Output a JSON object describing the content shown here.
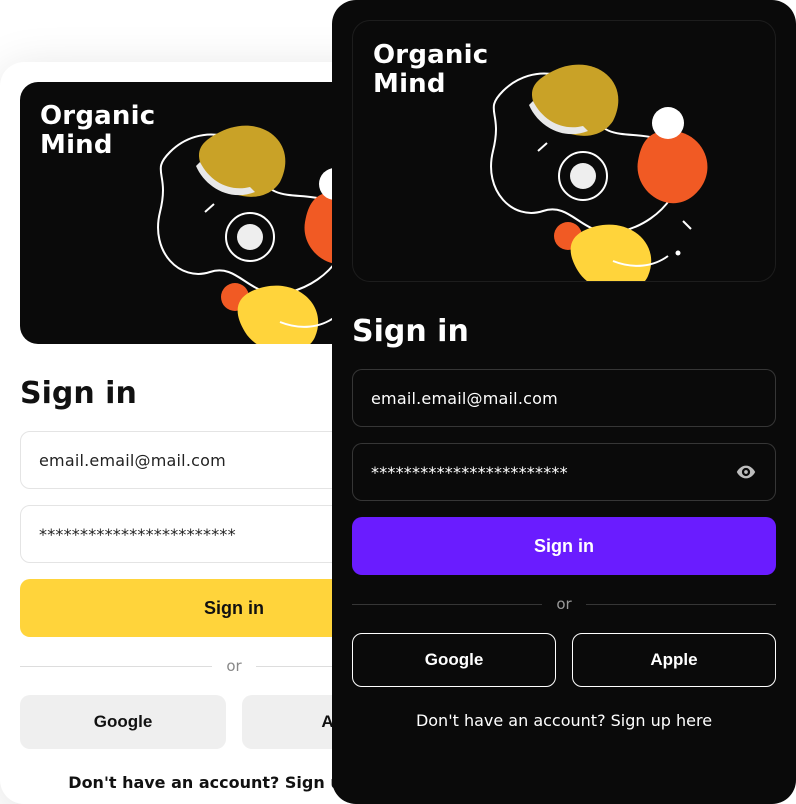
{
  "brand": {
    "line1": "Organic",
    "line2": "Mind"
  },
  "light": {
    "heading": "Sign in",
    "email": {
      "value": "email.email@mail.com"
    },
    "password": {
      "masked": "************************"
    },
    "primary_label": "Sign in",
    "divider_label": "or",
    "social": {
      "google": "Google",
      "apple": "Apple"
    },
    "footer": "Don't have an account? Sign up here",
    "colors": {
      "primary": "#ffd43b"
    }
  },
  "dark": {
    "heading": "Sign in",
    "email": {
      "value": "email.email@mail.com"
    },
    "password": {
      "masked": "************************"
    },
    "primary_label": "Sign in",
    "divider_label": "or",
    "social": {
      "google": "Google",
      "apple": "Apple"
    },
    "footer": "Don't have an account? Sign up here",
    "colors": {
      "primary": "#6a1cff"
    }
  },
  "icons": {
    "eye": "eye-icon"
  }
}
